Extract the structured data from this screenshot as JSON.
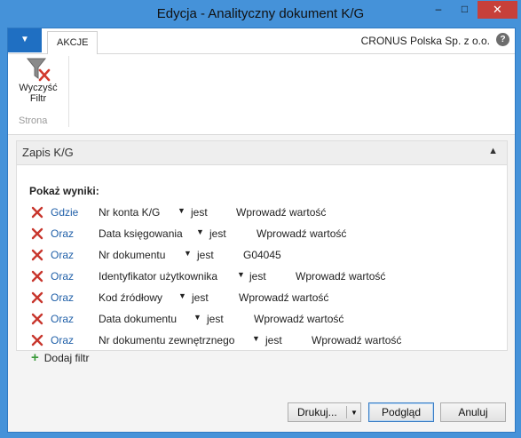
{
  "window": {
    "title": "Edycja - Analityczny dokument K/G",
    "minimize": "–",
    "maximize": "□",
    "close": "✕"
  },
  "ribbon": {
    "app_menu_glyph": "▼",
    "tab_label": "AKCJE",
    "company": "CRONUS Polska Sp. z o.o.",
    "help_glyph": "?",
    "clear_filter_label_line1": "Wyczyść",
    "clear_filter_label_line2": "Filtr",
    "group_label": "Strona"
  },
  "panel": {
    "title": "Zapis K/G",
    "collapse_glyph": "▲",
    "show_results": "Pokaż wyniki:",
    "filters": [
      {
        "link": "Gdzie",
        "field": "Nr konta K/G",
        "op": "jest",
        "value": "Wprowadź wartość"
      },
      {
        "link": "Oraz",
        "field": "Data księgowania",
        "op": "jest",
        "value": "Wprowadź wartość"
      },
      {
        "link": "Oraz",
        "field": "Nr dokumentu",
        "op": "jest",
        "value": "G04045"
      },
      {
        "link": "Oraz",
        "field": "Identyfikator użytkownika",
        "op": "jest",
        "value": "Wprowadź wartość"
      },
      {
        "link": "Oraz",
        "field": "Kod źródłowy",
        "op": "jest",
        "value": "Wprowadź wartość"
      },
      {
        "link": "Oraz",
        "field": "Data dokumentu",
        "op": "jest",
        "value": "Wprowadź wartość"
      },
      {
        "link": "Oraz",
        "field": "Nr dokumentu zewnętrznego",
        "op": "jest",
        "value": "Wprowadź wartość"
      }
    ],
    "add_filter": "Dodaj filtr",
    "add_glyph": "+"
  },
  "footer": {
    "print_label": "Drukuj...",
    "print_arrow": "▼",
    "preview_label": "Podgląd",
    "cancel_label": "Anuluj"
  },
  "colors": {
    "titlebar": "#4592d9",
    "close_button": "#c7403a",
    "link": "#1f5fa8",
    "delete_icon": "#c8362d"
  }
}
